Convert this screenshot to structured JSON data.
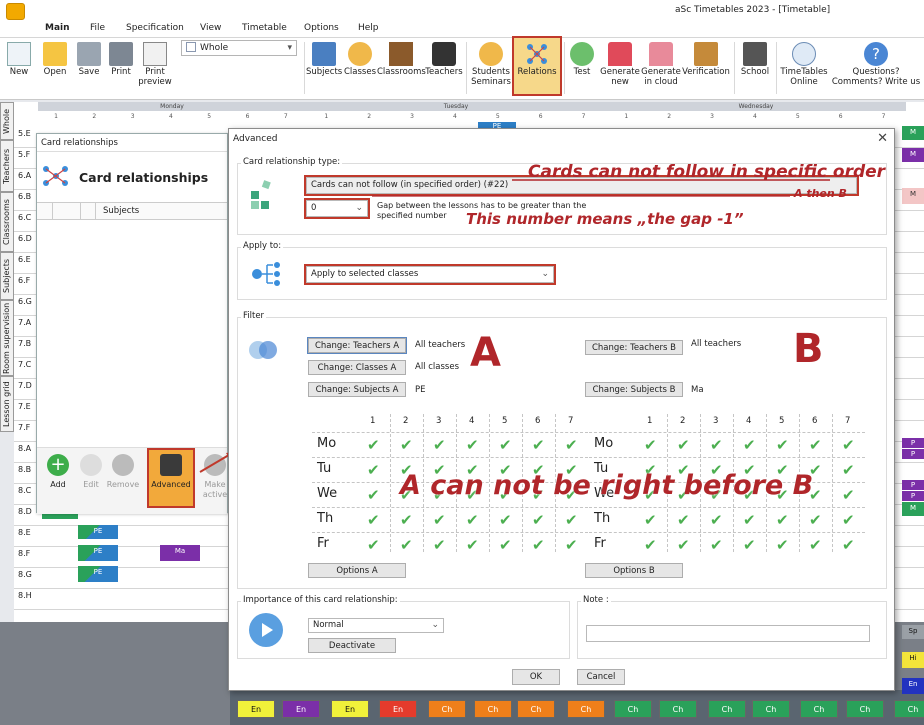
{
  "window": {
    "title": "aSc Timetables 2023  - [Timetable]"
  },
  "menu": {
    "tabs": [
      "Main",
      "File",
      "Specification",
      "View",
      "Timetable",
      "Options",
      "Help"
    ]
  },
  "ribbon": {
    "left": [
      {
        "label": "New"
      },
      {
        "label": "Open"
      },
      {
        "label": "Save"
      },
      {
        "label": "Print"
      },
      {
        "label": "Print\npreview"
      }
    ],
    "view_select": "Whole",
    "items": [
      "Subjects",
      "Classes",
      "Classrooms",
      "Teachers",
      "Students\nSeminars",
      "Relations",
      "Test",
      "Generate\nnew",
      "Generate\nin cloud",
      "Verification",
      "School",
      "TimeTables\nOnline",
      "Questions?\nComments? Write us"
    ]
  },
  "side_tabs": [
    "Whole",
    "Teachers",
    "Classrooms",
    "Subjects",
    "Room supervision",
    "Lesson grid"
  ],
  "grid": {
    "days": [
      "Monday",
      "Tuesday",
      "Wednesday"
    ],
    "periods": [
      "1",
      "2",
      "3",
      "4",
      "5",
      "6",
      "7"
    ],
    "rows": [
      "5.E",
      "5.F",
      "6.A",
      "6.B",
      "6.C",
      "6.D",
      "6.E",
      "6.F",
      "6.G",
      "7.A",
      "7.B",
      "7.C",
      "7.D",
      "7.E",
      "7.F",
      "8.A",
      "8.B",
      "8.C",
      "8.D",
      "8.E",
      "8.F",
      "8.G",
      "8.H"
    ],
    "cards": [
      "PE",
      "PE",
      "PE",
      "Ma",
      "PE",
      "Ma"
    ],
    "bottom_cards": [
      "En",
      "En",
      "En",
      "En",
      "Ch",
      "Ch",
      "Ch",
      "Ch",
      "Ch",
      "Ch",
      "Ch",
      "Ch",
      "Ch",
      "Ch",
      "Ch",
      "Ch"
    ],
    "right_cards": [
      "M",
      "M",
      "M",
      "P",
      "P",
      "P",
      "P",
      "M",
      "Sp",
      "Hi",
      "En",
      "Ch"
    ]
  },
  "card_rel_window": {
    "title": "Card relationships",
    "heading": "Card relationships",
    "col_subjects": "Subjects",
    "buttons": [
      {
        "label": "Add"
      },
      {
        "label": "Edit"
      },
      {
        "label": "Remove"
      },
      {
        "label": "Advanced"
      },
      {
        "label": "Make\nactive"
      }
    ]
  },
  "dialog": {
    "title": "Advanced",
    "type_label": "Card relationship type:",
    "type_value": "Cards can not follow (in specified order) (#22)",
    "gap_value": "0",
    "gap_text": "Gap between the lessons has to be greater than the specified number",
    "apply_label": "Apply to:",
    "apply_value": "Apply to selected classes",
    "filter_label": "Filter",
    "filterA": {
      "teachers_btn": "Change: Teachers A",
      "teachers_val": "All teachers",
      "classes_btn": "Change: Classes A",
      "classes_val": "All classes",
      "subjects_btn": "Change: Subjects A",
      "subjects_val": "PE",
      "options_btn": "Options A"
    },
    "filterB": {
      "teachers_btn": "Change: Teachers B",
      "teachers_val": "All teachers",
      "subjects_btn": "Change: Subjects B",
      "subjects_val": "Ma",
      "options_btn": "Options B"
    },
    "days": [
      "Mo",
      "Tu",
      "We",
      "Th",
      "Fr"
    ],
    "periods": [
      "1",
      "2",
      "3",
      "4",
      "5",
      "6",
      "7"
    ],
    "importance_label": "Importance of this card relationship:",
    "importance_value": "Normal",
    "deactivate_btn": "Deactivate",
    "note_label": "Note :",
    "ok": "OK",
    "cancel": "Cancel"
  },
  "annotations": {
    "title": "Cards can not follow in specific order",
    "sub": "A then B",
    "gap": "This number means „the gap -1”",
    "A": "A",
    "B": "B",
    "rule": "A can not be right before B"
  }
}
